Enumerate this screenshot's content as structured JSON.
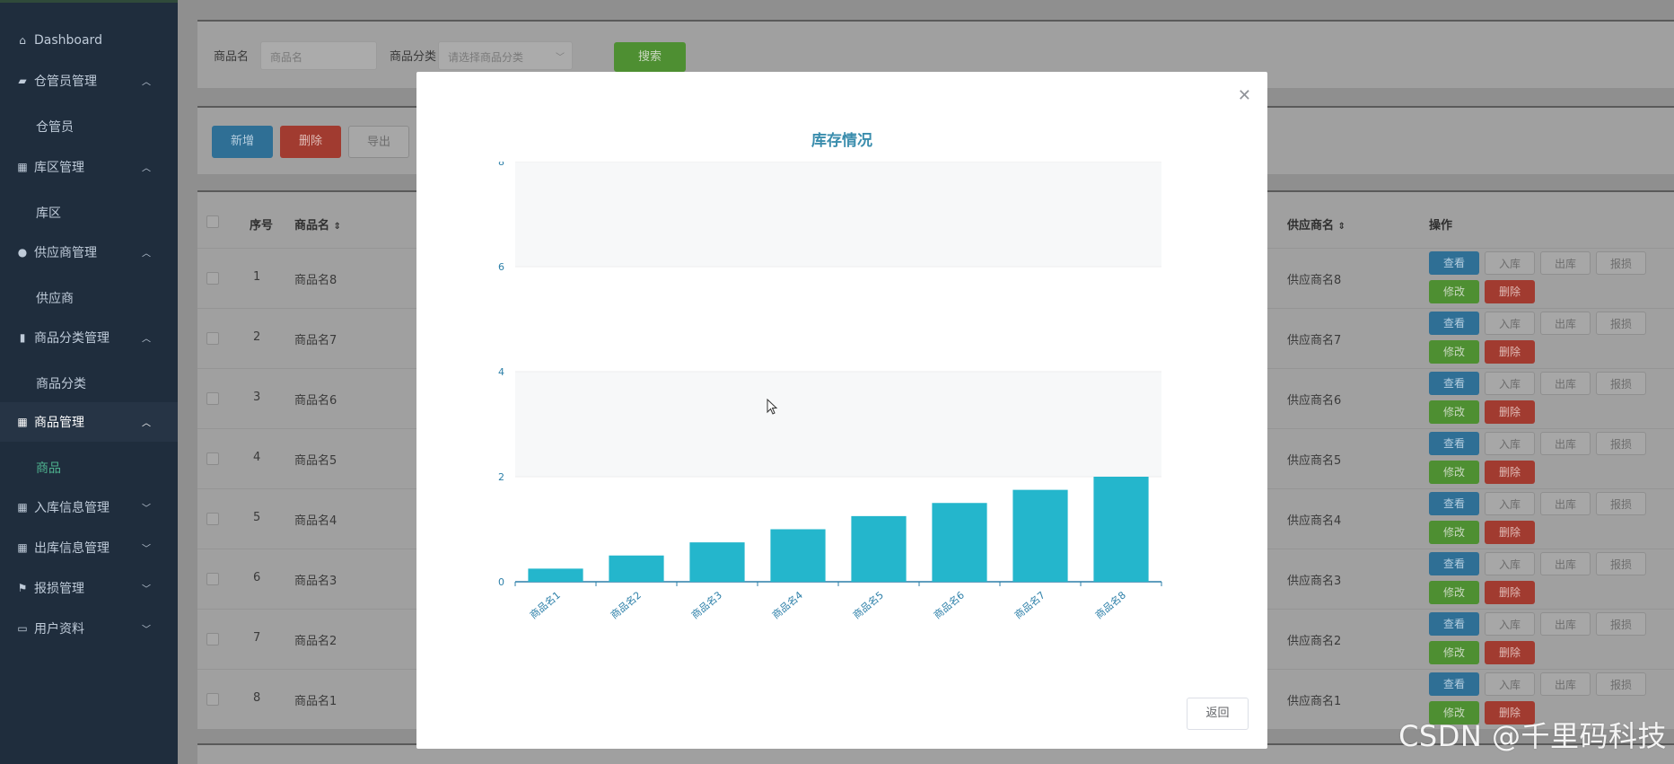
{
  "sidebar": {
    "items": [
      {
        "label": "Dashboard",
        "icon": "home-icon",
        "type": "item"
      },
      {
        "label": "仓管员管理",
        "icon": "truck-icon",
        "type": "group",
        "arrow": "up"
      },
      {
        "label": "仓管员",
        "type": "sub"
      },
      {
        "label": "库区管理",
        "icon": "building-icon",
        "type": "group",
        "arrow": "up"
      },
      {
        "label": "库区",
        "type": "sub"
      },
      {
        "label": "供应商管理",
        "icon": "user-icon",
        "type": "group",
        "arrow": "up"
      },
      {
        "label": "供应商",
        "type": "sub"
      },
      {
        "label": "商品分类管理",
        "icon": "columns-icon",
        "type": "group",
        "arrow": "up"
      },
      {
        "label": "商品分类",
        "type": "sub"
      },
      {
        "label": "商品管理",
        "icon": "grid-icon",
        "type": "group",
        "arrow": "up",
        "active": true
      },
      {
        "label": "商品",
        "type": "sub",
        "active": true
      },
      {
        "label": "入库信息管理",
        "icon": "grid-icon",
        "type": "group",
        "arrow": "down"
      },
      {
        "label": "出库信息管理",
        "icon": "grid-icon",
        "type": "group",
        "arrow": "down"
      },
      {
        "label": "报损管理",
        "icon": "flag-icon",
        "type": "group",
        "arrow": "down"
      },
      {
        "label": "用户资料",
        "icon": "card-icon",
        "type": "group",
        "arrow": "down"
      }
    ]
  },
  "search": {
    "name_label": "商品名",
    "name_placeholder": "商品名",
    "category_label": "商品分类",
    "category_placeholder": "请选择商品分类",
    "search_button": "搜索"
  },
  "toolbar": {
    "add": "新增",
    "delete": "删除",
    "export": "导出"
  },
  "table": {
    "headers": {
      "index": "序号",
      "name": "商品名",
      "supplier": "供应商名",
      "actions": "操作"
    },
    "rows": [
      {
        "index": "1",
        "name": "商品名8",
        "supplier": "供应商名8"
      },
      {
        "index": "2",
        "name": "商品名7",
        "supplier": "供应商名7"
      },
      {
        "index": "3",
        "name": "商品名6",
        "supplier": "供应商名6"
      },
      {
        "index": "4",
        "name": "商品名5",
        "supplier": "供应商名5"
      },
      {
        "index": "5",
        "name": "商品名4",
        "supplier": "供应商名4"
      },
      {
        "index": "6",
        "name": "商品名3",
        "supplier": "供应商名3"
      },
      {
        "index": "7",
        "name": "商品名2",
        "supplier": "供应商名2"
      },
      {
        "index": "8",
        "name": "商品名1",
        "supplier": "供应商名1"
      }
    ],
    "row_actions": {
      "view": "查看",
      "in": "入库",
      "out": "出库",
      "damage": "报损",
      "edit": "修改",
      "delete": "删除"
    }
  },
  "modal": {
    "close_icon": "close-icon",
    "back_button": "返回"
  },
  "chart_data": {
    "type": "bar",
    "title": "库存情况",
    "categories": [
      "商品名1",
      "商品名2",
      "商品名3",
      "商品名4",
      "商品名5",
      "商品名6",
      "商品名7",
      "商品名8"
    ],
    "values": [
      0.25,
      0.5,
      0.75,
      1.0,
      1.25,
      1.5,
      1.75,
      2.0
    ],
    "ylim": [
      0,
      8
    ],
    "yticks": [
      "0",
      "2",
      "4",
      "6",
      "8"
    ],
    "grid": true,
    "bar_color": "#24b6cc",
    "axis_color": "#2c7fa8"
  },
  "watermark": "CSDN @千里码科技"
}
